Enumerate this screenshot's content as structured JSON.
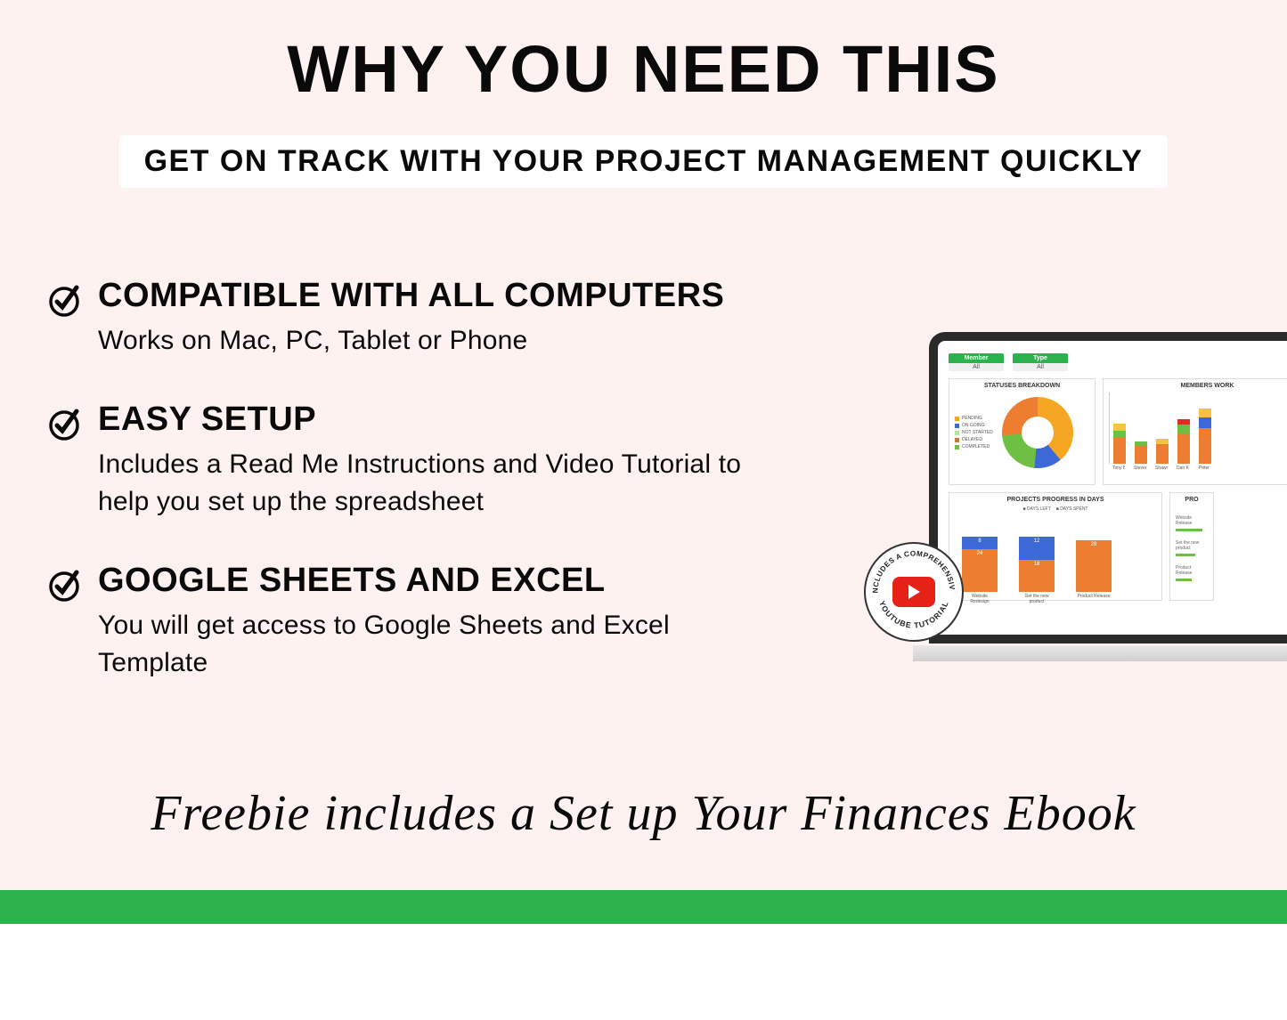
{
  "heading": "WHY YOU NEED THIS",
  "subheading": "GET ON TRACK WITH YOUR PROJECT MANAGEMENT QUICKLY",
  "features": [
    {
      "title": "COMPATIBLE WITH ALL COMPUTERS",
      "desc": "Works on Mac, PC, Tablet or Phone"
    },
    {
      "title": "EASY SETUP",
      "desc": "Includes a Read Me Instructions and Video Tutorial  to help you set up the spreadsheet"
    },
    {
      "title": "GOOGLE SHEETS AND EXCEL",
      "desc": "You will get access to Google Sheets and Excel Template"
    }
  ],
  "freebie": "Freebie includes a Set up Your Finances Ebook",
  "badge_top": "INCLUDES A COMPREHENSIVE",
  "badge_bottom": "YOUTUBE TUTORIAL",
  "dashboard": {
    "filters": [
      {
        "label": "Member",
        "value": "All"
      },
      {
        "label": "Type",
        "value": "All"
      }
    ],
    "card1_title": "STATUSES BREAKDOWN",
    "card2_title": "MEMBERS WORK",
    "card3_title": "PROJECTS PROGRESS IN DAYS",
    "card4_title": "PRO",
    "legend_items": [
      "PENDING",
      "ON GOING",
      "NOT STARTED",
      "DELAYED",
      "COMPLETED"
    ],
    "legend_colors": [
      "#f5a623",
      "#3d68d8",
      "#b5e3a1",
      "#c97b3a",
      "#6fbf44"
    ],
    "legend2": [
      "DAYS LEFT",
      "DAYS SPENT"
    ],
    "prog_labels": [
      "Website Redesign",
      "Get the new product",
      "Product Release"
    ],
    "member_labels": [
      "Tony Blue",
      "Steven Hodges",
      "Shawn Penn",
      "Dan Kesner",
      "Peter"
    ]
  }
}
